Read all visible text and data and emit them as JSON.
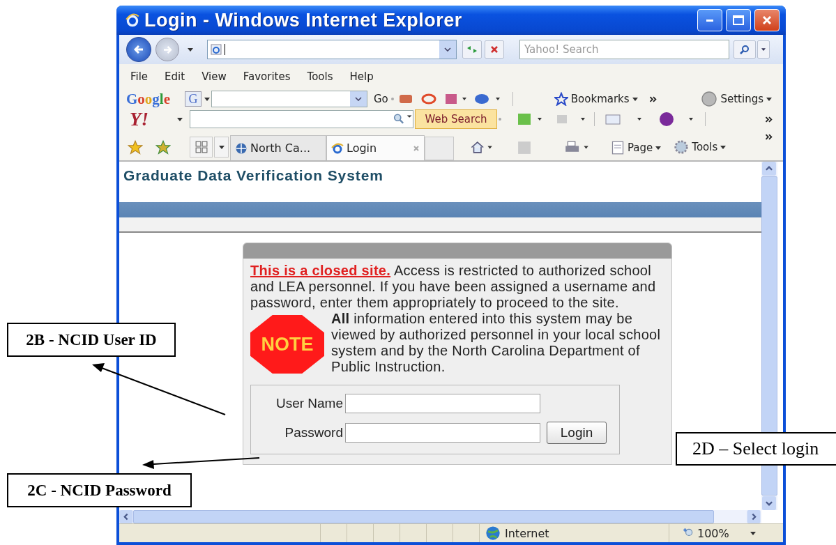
{
  "window": {
    "title": "Login - Windows Internet Explorer"
  },
  "search": {
    "placeholder": "Yahoo! Search"
  },
  "menu": [
    "File",
    "Edit",
    "View",
    "Favorites",
    "Tools",
    "Help"
  ],
  "google_toolbar": {
    "logo": "Google",
    "engine_button": "G",
    "go": "Go",
    "bookmarks": "Bookmarks",
    "settings": "Settings"
  },
  "yahoo_toolbar": {
    "logo": "Y!",
    "search_button": "Web Search"
  },
  "tabs": [
    {
      "label": "North Ca...",
      "selected": false
    },
    {
      "label": "Login",
      "selected": true
    }
  ],
  "command_bar": [
    "Page",
    "Tools"
  ],
  "page": {
    "site_title": "Graduate Data Verification System",
    "warning": {
      "link": "This is a closed site.",
      "text": "Access is restricted to authorized school and LEA personnel. If you have been assigned a username and password, enter them appropriately to proceed to the site."
    },
    "note": {
      "badge": "NOTE",
      "text": "**All** information entered into this system may be viewed by authorized personnel in your local school system and by the North Carolina Department of Public Instruction."
    },
    "fields": [
      {
        "label": "User Name"
      },
      {
        "label": "Password"
      }
    ],
    "login_button": "Login"
  },
  "status_bar": {
    "zone": "Internet",
    "zoom": "100%"
  },
  "callouts": [
    {
      "text": "2B - NCID User ID",
      "kind": "bold"
    },
    {
      "text": "2C - NCID Password",
      "kind": "bold"
    },
    {
      "text": "2D – Select login",
      "kind": "plain"
    }
  ]
}
